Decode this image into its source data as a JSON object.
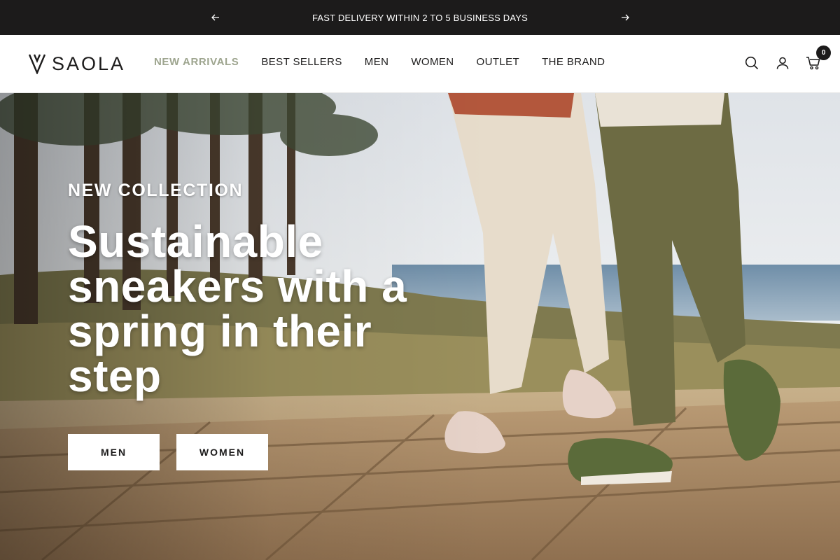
{
  "announcement": {
    "message": "FAST DELIVERY WITHIN 2 TO 5 BUSINESS DAYS",
    "prev_icon": "arrow-left-icon",
    "next_icon": "arrow-right-icon"
  },
  "header": {
    "logo_text": "SAOLA",
    "nav": [
      {
        "label": "NEW ARRIVALS",
        "active": true
      },
      {
        "label": "BEST SELLERS",
        "active": false
      },
      {
        "label": "MEN",
        "active": false
      },
      {
        "label": "WOMEN",
        "active": false
      },
      {
        "label": "OUTLET",
        "active": false
      },
      {
        "label": "THE BRAND",
        "active": false
      }
    ],
    "icons": [
      "search-icon",
      "account-icon",
      "cart-icon"
    ],
    "cart_count": "0"
  },
  "hero": {
    "eyebrow": "NEW COLLECTION",
    "headline": "Sustainable sneakers with a spring in their step",
    "buttons": [
      {
        "label": "MEN"
      },
      {
        "label": "WOMEN"
      }
    ]
  },
  "colors": {
    "bar": "#1c1b1b",
    "accent": "#9ea58f",
    "text": "#1c1b1b"
  }
}
